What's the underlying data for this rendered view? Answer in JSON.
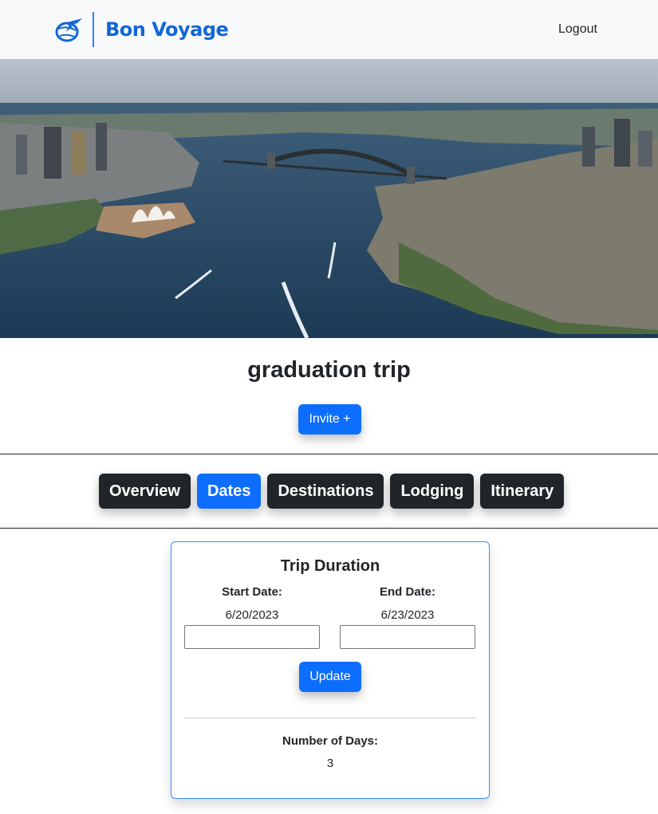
{
  "header": {
    "brand_name": "Bon Voyage",
    "logo_icon": "plane-globe-icon",
    "logout_label": "Logout",
    "brand_color": "#1166d6"
  },
  "hero": {
    "image": "aerial-harbour-city-photo"
  },
  "trip": {
    "title": "graduation trip",
    "invite_label": "Invite +"
  },
  "tabs": [
    {
      "label": "Overview",
      "active": false
    },
    {
      "label": "Dates",
      "active": true
    },
    {
      "label": "Destinations",
      "active": false
    },
    {
      "label": "Lodging",
      "active": false
    },
    {
      "label": "Itinerary",
      "active": false
    }
  ],
  "duration_card": {
    "title": "Trip Duration",
    "start_label": "Start Date:",
    "start_value": "6/20/2023",
    "start_input_value": "",
    "end_label": "End Date:",
    "end_value": "6/23/2023",
    "end_input_value": "",
    "update_label": "Update",
    "days_label": "Number of Days:",
    "days_value": "3"
  },
  "colors": {
    "primary": "#0d6efd",
    "dark": "#212529",
    "navbar_bg": "#f8f9fa"
  }
}
